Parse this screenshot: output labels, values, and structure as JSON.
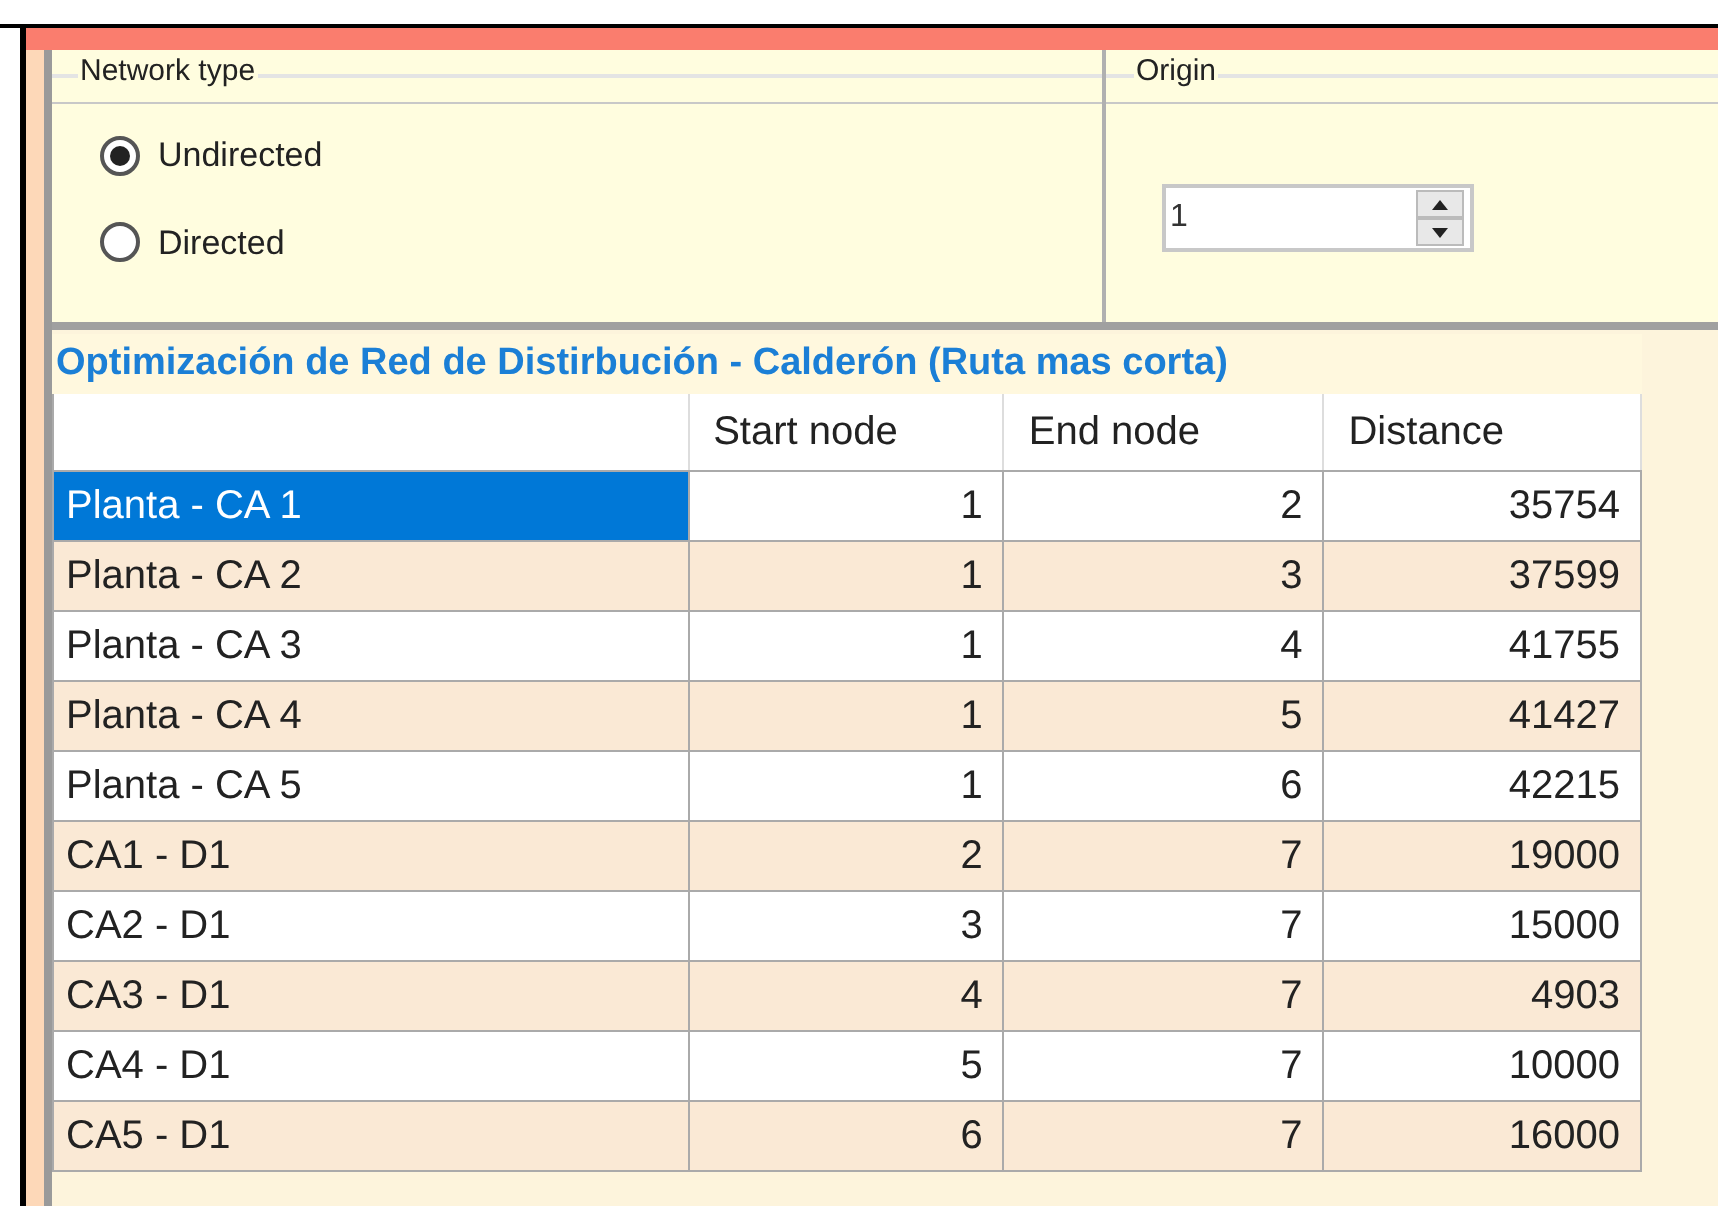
{
  "network_type": {
    "title": "Network type",
    "options": [
      {
        "label": "Undirected",
        "selected": true
      },
      {
        "label": "Directed",
        "selected": false
      }
    ]
  },
  "origin": {
    "title": "Origin",
    "value": "1"
  },
  "grid": {
    "title": "Optimización de Red de Distirbución - Calderón (Ruta mas corta)",
    "columns": [
      "Start node",
      "End node",
      "Distance"
    ],
    "rows": [
      {
        "label": "Planta - CA 1",
        "selected": true,
        "cells": [
          "1",
          "2",
          "35754"
        ]
      },
      {
        "label": "Planta - CA 2",
        "selected": false,
        "cells": [
          "1",
          "3",
          "37599"
        ]
      },
      {
        "label": "Planta - CA 3",
        "selected": false,
        "cells": [
          "1",
          "4",
          "41755"
        ]
      },
      {
        "label": "Planta - CA 4",
        "selected": false,
        "cells": [
          "1",
          "5",
          "41427"
        ]
      },
      {
        "label": "Planta - CA 5",
        "selected": false,
        "cells": [
          "1",
          "6",
          "42215"
        ]
      },
      {
        "label": "CA1 - D1",
        "selected": false,
        "cells": [
          "2",
          "7",
          "19000"
        ]
      },
      {
        "label": "CA2 - D1",
        "selected": false,
        "cells": [
          "3",
          "7",
          "15000"
        ]
      },
      {
        "label": "CA3 - D1",
        "selected": false,
        "cells": [
          "4",
          "7",
          "4903"
        ]
      },
      {
        "label": "CA4 - D1",
        "selected": false,
        "cells": [
          "5",
          "7",
          "10000"
        ]
      },
      {
        "label": "CA5 - D1",
        "selected": false,
        "cells": [
          "6",
          "7",
          "16000"
        ]
      }
    ]
  }
}
